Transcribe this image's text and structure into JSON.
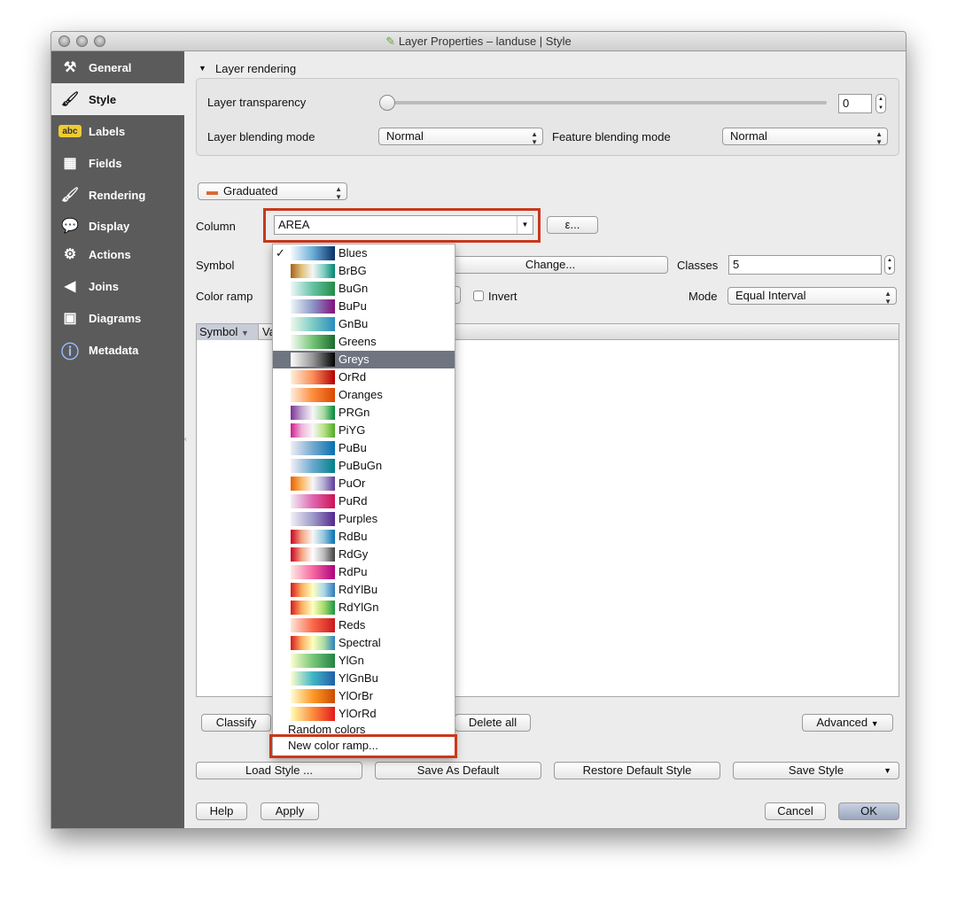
{
  "window": {
    "title": "Layer Properties – landuse | Style"
  },
  "sidebar": {
    "items": [
      {
        "label": "General",
        "icon": "tools-icon"
      },
      {
        "label": "Style",
        "icon": "paintbrush-icon",
        "selected": true
      },
      {
        "label": "Labels",
        "icon": "abc-label-icon"
      },
      {
        "label": "Fields",
        "icon": "table-icon"
      },
      {
        "label": "Rendering",
        "icon": "brush-icon"
      },
      {
        "label": "Display",
        "icon": "speech-bubble-icon"
      },
      {
        "label": "Actions",
        "icon": "gear-icon"
      },
      {
        "label": "Joins",
        "icon": "join-icon"
      },
      {
        "label": "Diagrams",
        "icon": "diagram-icon"
      },
      {
        "label": "Metadata",
        "icon": "info-icon"
      }
    ]
  },
  "layer_rendering": {
    "header": "Layer rendering",
    "transparency_label": "Layer transparency",
    "transparency_value": "0",
    "transparency_fraction": 0,
    "blending_label": "Layer blending mode",
    "blending_value": "Normal",
    "feature_blending_label": "Feature blending mode",
    "feature_blending_value": "Normal"
  },
  "renderer": {
    "type": "Graduated",
    "column_label": "Column",
    "column_value": "AREA",
    "expression_button": "ε...",
    "symbol_label": "Symbol",
    "change_button": "Change...",
    "classes_label": "Classes",
    "classes_value": "5",
    "color_ramp_label": "Color ramp",
    "invert_label": "Invert",
    "invert_checked": false,
    "mode_label": "Mode",
    "mode_value": "Equal Interval"
  },
  "table": {
    "columns": [
      "Symbol",
      "Va"
    ]
  },
  "buttons": {
    "classify": "Classify",
    "delete_all": "Delete all",
    "advanced": "Advanced",
    "load_style": "Load Style ...",
    "save_default": "Save As Default",
    "restore_default": "Restore Default Style",
    "save_style": "Save Style",
    "help": "Help",
    "apply": "Apply",
    "cancel": "Cancel",
    "ok": "OK"
  },
  "ramp_popup": {
    "selected": "Blues",
    "highlighted": "Greys",
    "items": [
      {
        "name": "Blues",
        "colors": [
          "#f7fbff",
          "#6baed6",
          "#08306b"
        ]
      },
      {
        "name": "BrBG",
        "colors": [
          "#a6611a",
          "#dfc27d",
          "#f5f5f5",
          "#80cdc1",
          "#018571"
        ]
      },
      {
        "name": "BuGn",
        "colors": [
          "#edf8fb",
          "#66c2a4",
          "#238b45"
        ]
      },
      {
        "name": "BuPu",
        "colors": [
          "#edf8fb",
          "#8c96c6",
          "#810f7c"
        ]
      },
      {
        "name": "GnBu",
        "colors": [
          "#f0f9e8",
          "#7bccc4",
          "#2b8cbe"
        ]
      },
      {
        "name": "Greens",
        "colors": [
          "#f7fcf5",
          "#74c476",
          "#1b6b2f"
        ]
      },
      {
        "name": "Greys",
        "colors": [
          "#ffffff",
          "#969696",
          "#000000"
        ]
      },
      {
        "name": "OrRd",
        "colors": [
          "#fef0d9",
          "#fc8d59",
          "#b30000"
        ]
      },
      {
        "name": "Oranges",
        "colors": [
          "#feedde",
          "#fd8d3c",
          "#d94701"
        ]
      },
      {
        "name": "PRGn",
        "colors": [
          "#7b3294",
          "#c2a5cf",
          "#f7f7f7",
          "#a6dba0",
          "#008837"
        ]
      },
      {
        "name": "PiYG",
        "colors": [
          "#d01c8b",
          "#f1b6da",
          "#f7f7f7",
          "#b8e186",
          "#4dac26"
        ]
      },
      {
        "name": "PuBu",
        "colors": [
          "#f1eef6",
          "#74a9cf",
          "#0570b0"
        ]
      },
      {
        "name": "PuBuGn",
        "colors": [
          "#f6eff7",
          "#67a9cf",
          "#02818a"
        ]
      },
      {
        "name": "PuOr",
        "colors": [
          "#e66101",
          "#fdb863",
          "#f7f7f7",
          "#b2abd2",
          "#5e3c99"
        ]
      },
      {
        "name": "PuRd",
        "colors": [
          "#f1eef6",
          "#df65b0",
          "#ce1256"
        ]
      },
      {
        "name": "Purples",
        "colors": [
          "#f2f0f7",
          "#9e9ac8",
          "#54278f"
        ]
      },
      {
        "name": "RdBu",
        "colors": [
          "#ca0020",
          "#f4a582",
          "#f7f7f7",
          "#92c5de",
          "#0571b0"
        ]
      },
      {
        "name": "RdGy",
        "colors": [
          "#ca0020",
          "#f4a582",
          "#ffffff",
          "#bababa",
          "#404040"
        ]
      },
      {
        "name": "RdPu",
        "colors": [
          "#feebe2",
          "#f768a1",
          "#ae017e"
        ]
      },
      {
        "name": "RdYlBu",
        "colors": [
          "#d7191c",
          "#fdae61",
          "#ffffbf",
          "#abd9e9",
          "#2c7bb6"
        ]
      },
      {
        "name": "RdYlGn",
        "colors": [
          "#d7191c",
          "#fdae61",
          "#ffffbf",
          "#a6d96a",
          "#1a9641"
        ]
      },
      {
        "name": "Reds",
        "colors": [
          "#fee5d9",
          "#fb6a4a",
          "#cb181d"
        ]
      },
      {
        "name": "Spectral",
        "colors": [
          "#d7191c",
          "#fdae61",
          "#ffffbf",
          "#abdda4",
          "#2b83ba"
        ]
      },
      {
        "name": "YlGn",
        "colors": [
          "#ffffcc",
          "#78c679",
          "#238443"
        ]
      },
      {
        "name": "YlGnBu",
        "colors": [
          "#ffffcc",
          "#41b6c4",
          "#225ea8"
        ]
      },
      {
        "name": "YlOrBr",
        "colors": [
          "#ffffd4",
          "#fe9929",
          "#cc4c02"
        ]
      },
      {
        "name": "YlOrRd",
        "colors": [
          "#ffffb2",
          "#fd8d3c",
          "#e31a1c"
        ]
      }
    ],
    "random_colors": "Random colors",
    "new_color_ramp": "New color ramp..."
  },
  "colors": {
    "highlight_box": "#c8381c",
    "sidebar_bg": "#5b5b5b",
    "menu_highlight": "#6e7480"
  }
}
